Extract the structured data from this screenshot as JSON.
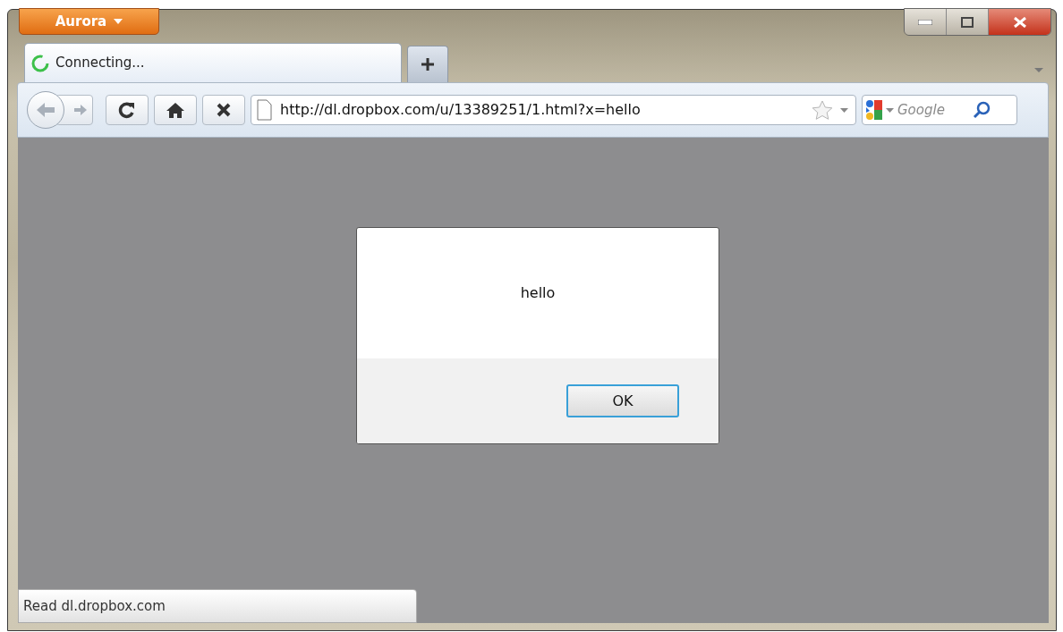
{
  "app_menu": {
    "label": "Aurora"
  },
  "tabs": [
    {
      "label": "Connecting...",
      "selected": true
    }
  ],
  "address_bar": {
    "value": "http://dl.dropbox.com/u/13389251/1.html?x=hello"
  },
  "search_field": {
    "placeholder": "Google"
  },
  "dialog": {
    "message": "hello",
    "buttons": [
      {
        "label": "OK",
        "selected": true
      }
    ]
  },
  "status_bar": {
    "text": "Read dl.dropbox.com"
  }
}
